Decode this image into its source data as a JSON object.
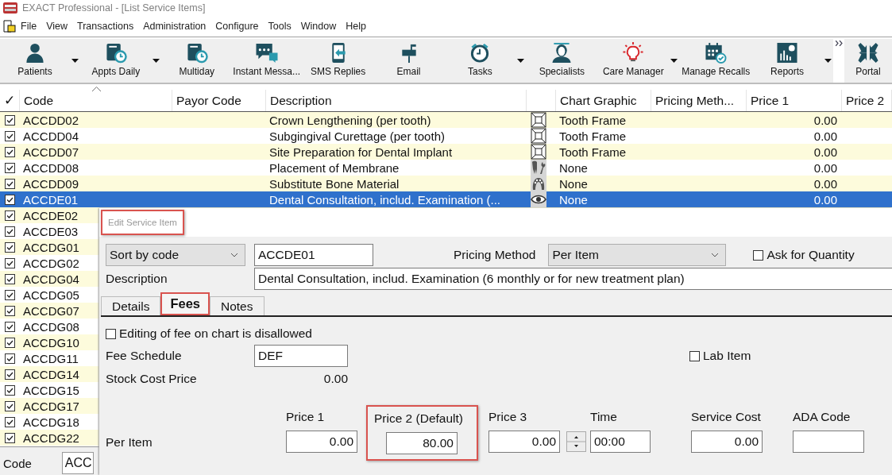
{
  "window": {
    "title": "EXACT Professional - [List Service Items]"
  },
  "menu": [
    "File",
    "View",
    "Transactions",
    "Administration",
    "Configure",
    "Tools",
    "Window",
    "Help"
  ],
  "toolbar": [
    {
      "kind": "button",
      "label": "Patients",
      "dropdown": true
    },
    {
      "kind": "button",
      "label": "Appts Daily",
      "dropdown": true
    },
    {
      "kind": "button",
      "label": "Multiday",
      "dropdown": false
    },
    {
      "kind": "button",
      "label": "Instant Messa...",
      "dropdown": false
    },
    {
      "kind": "button",
      "label": "SMS Replies",
      "dropdown": false
    },
    {
      "kind": "button",
      "label": "Email",
      "dropdown": false
    },
    {
      "kind": "button",
      "label": "Tasks",
      "dropdown": true
    },
    {
      "kind": "button",
      "label": "Specialists",
      "dropdown": false
    },
    {
      "kind": "button",
      "label": "Care Manager",
      "dropdown": true
    },
    {
      "kind": "button",
      "label": "Manage Recalls",
      "dropdown": false
    },
    {
      "kind": "button",
      "label": "Reports",
      "dropdown": true
    },
    {
      "kind": "overflow"
    },
    {
      "kind": "button",
      "label": "Portal",
      "dropdown": false
    }
  ],
  "table": {
    "columns": [
      {
        "kind": "check",
        "label": "✓",
        "sorted": false
      },
      {
        "kind": "text",
        "label": "Code",
        "sorted": true
      },
      {
        "kind": "text",
        "label": "Payor Code",
        "sorted": false
      },
      {
        "kind": "text",
        "label": "Description",
        "sorted": false
      },
      {
        "kind": "graphic",
        "sorted": false
      },
      {
        "kind": "text",
        "label": "Chart Graphic",
        "sorted": false
      },
      {
        "kind": "text",
        "label": "Pricing Meth...",
        "sorted": false
      },
      {
        "kind": "text",
        "label": "Price 1",
        "sorted": false
      },
      {
        "kind": "text",
        "label": "Price 2",
        "sorted": false
      }
    ],
    "rows": [
      {
        "checked": true,
        "selected": false,
        "code": "ACCDD02",
        "description": "Crown Lengthening (per tooth)",
        "chart_graphic": "Tooth Frame",
        "price_1": "0.00"
      },
      {
        "checked": true,
        "selected": false,
        "code": "ACCDD04",
        "description": "Subgingival Curettage (per tooth)",
        "chart_graphic": "Tooth Frame",
        "price_1": "0.00"
      },
      {
        "checked": true,
        "selected": false,
        "code": "ACCDD07",
        "description": "Site Preparation for Dental Implant",
        "chart_graphic": "Tooth Frame",
        "price_1": "0.00"
      },
      {
        "checked": true,
        "selected": false,
        "code": "ACCDD08",
        "description": "Placement of Membrane",
        "chart_graphic": "None",
        "price_1": "0.00"
      },
      {
        "checked": true,
        "selected": false,
        "code": "ACCDD09",
        "description": "Substitute Bone Material",
        "chart_graphic": "None",
        "price_1": "0.00"
      },
      {
        "checked": true,
        "selected": true,
        "code": "ACCDE01",
        "description": "Dental Consultation, includ. Examination (...",
        "chart_graphic": "None",
        "price_1": "0.00"
      },
      {
        "checked": true,
        "selected": false,
        "code": "ACCDE02"
      },
      {
        "checked": true,
        "selected": false,
        "code": "ACCDE03"
      },
      {
        "checked": true,
        "selected": false,
        "code": "ACCDG01"
      },
      {
        "checked": true,
        "selected": false,
        "code": "ACCDG02"
      },
      {
        "checked": true,
        "selected": false,
        "code": "ACCDG04"
      },
      {
        "checked": true,
        "selected": false,
        "code": "ACCDG05"
      },
      {
        "checked": true,
        "selected": false,
        "code": "ACCDG07"
      },
      {
        "checked": true,
        "selected": false,
        "code": "ACCDG08"
      },
      {
        "checked": true,
        "selected": false,
        "code": "ACCDG10"
      },
      {
        "checked": true,
        "selected": false,
        "code": "ACCDG11"
      },
      {
        "checked": true,
        "selected": false,
        "code": "ACCDG14"
      },
      {
        "checked": true,
        "selected": false,
        "code": "ACCDG15"
      },
      {
        "checked": true,
        "selected": false,
        "code": "ACCDG17"
      },
      {
        "checked": true,
        "selected": false,
        "code": "ACCDG18"
      },
      {
        "checked": true,
        "selected": false,
        "code": "ACCDG22"
      }
    ]
  },
  "footer": {
    "label": "Code",
    "value": "ACC"
  },
  "dialog": {
    "title": "Edit Service Item",
    "title_highlighted": true,
    "sort": "Sort by code",
    "code": "ACCDE01",
    "pricing_method_label": "Pricing Method",
    "pricing_method": "Per Item",
    "ask_quantity": {
      "label": "Ask for Quantity",
      "checked": false
    },
    "description_label": "Description",
    "description": "Dental Consultation, includ. Examination (6 monthly or for new treatment plan)",
    "tabs": [
      {
        "label": "Details",
        "selected": false,
        "highlighted": false
      },
      {
        "label": "Fees",
        "selected": true,
        "highlighted": true
      },
      {
        "label": "Notes",
        "selected": false,
        "highlighted": false
      }
    ],
    "fee_edit": {
      "label": "Editing of fee on chart is disallowed",
      "checked": false
    },
    "fee_schedule_label": "Fee Schedule",
    "fee_schedule": "DEF",
    "lab_item": {
      "label": "Lab Item",
      "checked": false
    },
    "stock_cost_label": "Stock Cost Price",
    "stock_cost": "0.00",
    "row_label": "Per Item",
    "price_fields": [
      {
        "kind": "amount",
        "label": "Price 1",
        "value": "0.00",
        "highlighted": false
      },
      {
        "kind": "amount",
        "label": "Price 2 (Default)",
        "value": "80.00",
        "highlighted": true
      },
      {
        "kind": "spin",
        "label": "Price 3",
        "value": "0.00",
        "highlighted": false
      },
      {
        "kind": "time",
        "label": "Time",
        "value": "00:00",
        "highlighted": false
      },
      {
        "kind": "amount",
        "label": "Service Cost",
        "value": "0.00",
        "highlighted": false
      },
      {
        "kind": "text",
        "label": "ADA Code",
        "highlighted": false
      }
    ]
  }
}
